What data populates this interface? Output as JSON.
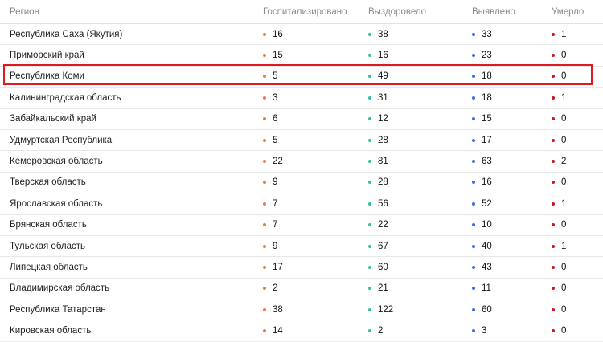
{
  "colors": {
    "hospitalized_dot": "#f07a47",
    "recovered_dot": "#2fc0a4",
    "detected_dot": "#3a6ee0",
    "died_dot": "#c9181c",
    "highlight": "#e0191f"
  },
  "headers": {
    "region": "Регион",
    "hospitalized": "Госпитализировано",
    "recovered": "Выздоровело",
    "detected": "Выявлено",
    "died": "Умерло"
  },
  "rows": [
    {
      "region": "Республика Саха (Якутия)",
      "hospitalized": "16",
      "recovered": "38",
      "detected": "33",
      "died": "1"
    },
    {
      "region": "Приморский край",
      "hospitalized": "15",
      "recovered": "16",
      "detected": "23",
      "died": "0"
    },
    {
      "region": "Республика Коми",
      "hospitalized": "5",
      "recovered": "49",
      "detected": "18",
      "died": "0"
    },
    {
      "region": "Калининградская область",
      "hospitalized": "3",
      "recovered": "31",
      "detected": "18",
      "died": "1"
    },
    {
      "region": "Забайкальский край",
      "hospitalized": "6",
      "recovered": "12",
      "detected": "15",
      "died": "0"
    },
    {
      "region": "Удмуртская Республика",
      "hospitalized": "5",
      "recovered": "28",
      "detected": "17",
      "died": "0"
    },
    {
      "region": "Кемеровская область",
      "hospitalized": "22",
      "recovered": "81",
      "detected": "63",
      "died": "2"
    },
    {
      "region": "Тверская область",
      "hospitalized": "9",
      "recovered": "28",
      "detected": "16",
      "died": "0"
    },
    {
      "region": "Ярославская область",
      "hospitalized": "7",
      "recovered": "56",
      "detected": "52",
      "died": "1"
    },
    {
      "region": "Брянская область",
      "hospitalized": "7",
      "recovered": "22",
      "detected": "10",
      "died": "0"
    },
    {
      "region": "Тульская область",
      "hospitalized": "9",
      "recovered": "67",
      "detected": "40",
      "died": "1"
    },
    {
      "region": "Липецкая область",
      "hospitalized": "17",
      "recovered": "60",
      "detected": "43",
      "died": "0"
    },
    {
      "region": "Владимирская область",
      "hospitalized": "2",
      "recovered": "21",
      "detected": "11",
      "died": "0"
    },
    {
      "region": "Республика Татарстан",
      "hospitalized": "38",
      "recovered": "122",
      "detected": "60",
      "died": "0"
    },
    {
      "region": "Кировская область",
      "hospitalized": "14",
      "recovered": "2",
      "detected": "3",
      "died": "0"
    }
  ]
}
